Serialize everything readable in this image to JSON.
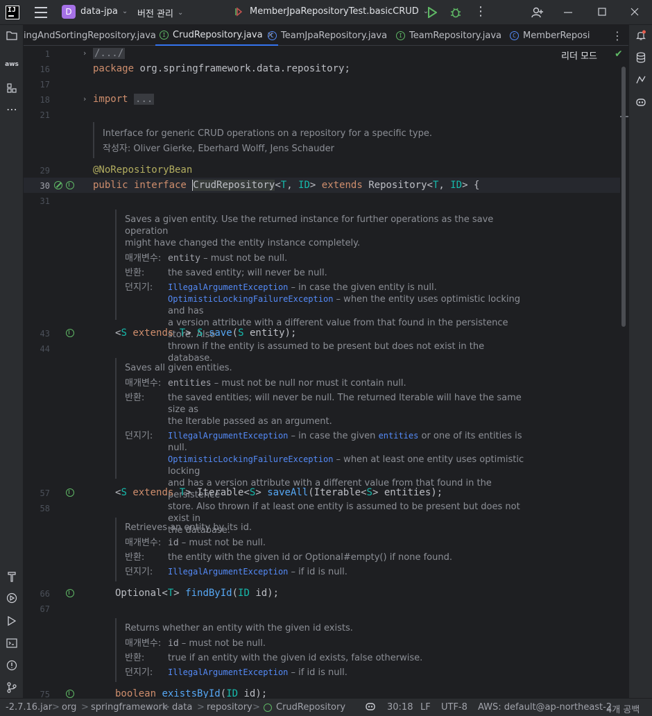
{
  "titlebar": {
    "project_badge": "D",
    "project_name": "data-jpa",
    "vcs": "버전 관리",
    "run_config": "MemberJpaRepositoryTest.basicCRUD"
  },
  "tabs": [
    {
      "label": "ingAndSortingRepository.java"
    },
    {
      "label": "CrudRepository.java",
      "close": "×"
    },
    {
      "label": "TeamJpaRepository.java"
    },
    {
      "label": "TeamRepository.java"
    },
    {
      "label": "MemberReposi"
    }
  ],
  "editor": {
    "reader_mode": "리더 모드",
    "lines": {
      "l1": "1",
      "l16": "16",
      "l17": "17",
      "l18": "18",
      "l21": "21",
      "l29": "29",
      "l30": "30",
      "l31": "31",
      "l43": "43",
      "l44": "44",
      "l57": "57",
      "l58": "58",
      "l66": "66",
      "l67": "67",
      "l75": "75"
    },
    "code": {
      "header_fold": "/.../",
      "package_kw": "package",
      "package_name": " org.springframework.data.repository;",
      "import_kw": "import",
      "import_fold": "...",
      "annotation": "@NoRepositoryBean",
      "decl_public": "public interface ",
      "decl_name": "CrudRepository",
      "decl_lt": "<",
      "decl_T": "T",
      "decl_comma": ", ",
      "decl_ID": "ID",
      "decl_gt": "> ",
      "decl_extends": "extends",
      "decl_repo": " Repository<",
      "decl_end": "> {",
      "save": {
        "lt": "<",
        "S": "S",
        "ext": "extends",
        "T": "T",
        "gt": "> ",
        "S2": "S",
        "name": "save",
        "paren": "(",
        "S3": "S",
        "end": " entity);"
      },
      "saveall": {
        "lt": "<",
        "S": "S",
        "ext": "extends",
        "T": "T",
        "gt": "> Iterable<",
        "S2": "S",
        "gt2": "> ",
        "name": "saveAll",
        "mid": "(Iterable<",
        "S3": "S",
        "end": "> entities);"
      },
      "findbyid": {
        "pre": "Optional<",
        "T": "T",
        "gt": "> ",
        "name": "findById",
        "paren": "(",
        "ID": "ID",
        "end": " id);"
      },
      "existsbyid": {
        "kw": "boolean",
        "name": "existsById",
        "paren": "(",
        "ID": "ID",
        "end": " id);"
      }
    },
    "docs": {
      "class_doc": "Interface for generic CRUD operations on a repository for a specific type.",
      "class_author_label": "작성자:",
      "class_author": "Oliver Gierke, Eberhard Wolff, Jens Schauder",
      "save_desc1": "Saves a given entity. Use the returned instance for further operations as the save operation",
      "save_desc2": "might have changed the entity instance completely.",
      "param_label": "매개변수:",
      "returns_label": "반환:",
      "throws_label": "던지기:",
      "save_param_code": "entity",
      "save_param_text": " – must not be null.",
      "save_returns": "the saved entity; will never be null.",
      "save_throws1_code": "IllegalArgumentException",
      "save_throws1_text": " – in case the given entity is null.",
      "save_throws2_code": "OptimisticLockingFailureException",
      "save_throws2_text": " – when the entity uses optimistic locking and has",
      "save_throws2_l2": "a version attribute with a different value from that found in the persistence store. Also",
      "save_throws2_l3": "thrown if the entity is assumed to be present but does not exist in the database.",
      "saveall_desc": "Saves all given entities.",
      "saveall_param_code": "entities",
      "saveall_param_text": " – must not be null nor must it contain null.",
      "saveall_returns1": "the saved entities; will never be null. The returned Iterable will have the same size as",
      "saveall_returns2": "the Iterable passed as an argument.",
      "saveall_throws1_code": "IllegalArgumentException",
      "saveall_throws1_text_a": " – in case the given ",
      "saveall_throws1_code2": "entities",
      "saveall_throws1_text_b": " or one of its entities is null.",
      "saveall_throws2_code": "OptimisticLockingFailureException",
      "saveall_throws2_text": " – when at least one entity uses optimistic locking",
      "saveall_throws2_l2": "and has a version attribute with a different value from that found in the persistence",
      "saveall_throws2_l3": "store. Also thrown if at least one entity is assumed to be present but does not exist in",
      "saveall_throws2_l4": "the database.",
      "find_desc": "Retrieves an entity by its id.",
      "find_param_code": "id",
      "find_param_text": " – must not be null.",
      "find_returns": "the entity with the given id or Optional#empty() if none found.",
      "find_throws_code": "IllegalArgumentException",
      "find_throws_text": " – if id is null.",
      "exists_desc": "Returns whether an entity with the given id exists.",
      "exists_param_code": "id",
      "exists_param_text": " – must not be null.",
      "exists_returns": "true if an entity with the given id exists, false otherwise.",
      "exists_throws_code": "IllegalArgumentException",
      "exists_throws_text": " – if id is null."
    }
  },
  "statusbar": {
    "crumbs": [
      "-2.7.16.jar",
      "org",
      "springframework",
      "data",
      "repository",
      "CrudRepository"
    ],
    "sep": ">",
    "position": "30:18",
    "line_sep": "LF",
    "encoding": "UTF-8",
    "aws": "AWS: default@ap-northeast-2",
    "indent": "4개 공백"
  }
}
